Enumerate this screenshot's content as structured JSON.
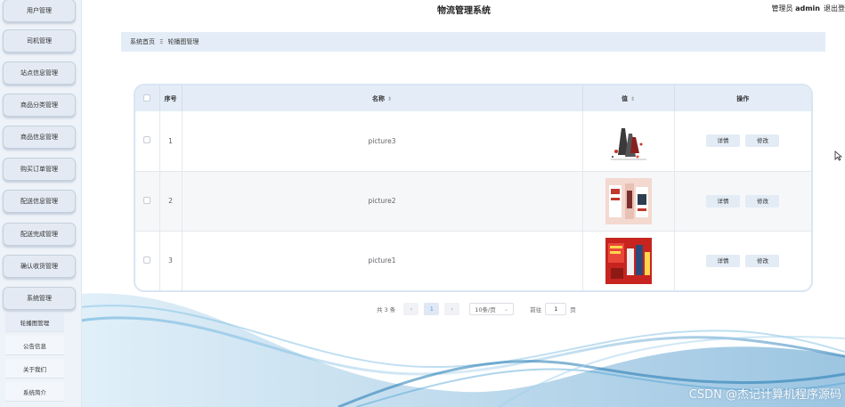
{
  "header": {
    "title": "物流管理系统",
    "admin_prefix": "管理员",
    "admin_name": "admin",
    "logout": "退出登录"
  },
  "sidebar": {
    "items": [
      {
        "label": "用户管理"
      },
      {
        "label": "司机管理"
      },
      {
        "label": "站点信息管理"
      },
      {
        "label": "商品分类管理"
      },
      {
        "label": "商品信息管理"
      },
      {
        "label": "购买订单管理"
      },
      {
        "label": "配送信息管理"
      },
      {
        "label": "配送完成管理"
      },
      {
        "label": "确认收货管理"
      },
      {
        "label": "系统管理"
      }
    ],
    "sub_items": [
      {
        "label": "轮播图管理"
      },
      {
        "label": "公告信息"
      },
      {
        "label": "关于我们"
      },
      {
        "label": "系统简介"
      }
    ]
  },
  "breadcrumb": {
    "home": "系统首页",
    "separator": "Ξ",
    "current": "轮播图管理"
  },
  "table": {
    "columns": {
      "index": "序号",
      "name": "名称",
      "value": "值",
      "actions": "操作"
    },
    "rows": [
      {
        "index": "1",
        "name": "picture3",
        "detail": "详情",
        "edit": "修改"
      },
      {
        "index": "2",
        "name": "picture2",
        "detail": "详情",
        "edit": "修改"
      },
      {
        "index": "3",
        "name": "picture1",
        "detail": "详情",
        "edit": "修改"
      }
    ]
  },
  "pagination": {
    "total": "共 3 条",
    "prev": "‹",
    "current_page": "1",
    "next": "›",
    "page_size": "10条/页",
    "goto_label": "前往",
    "goto_value": "1",
    "page_suffix": "页"
  },
  "watermark": "CSDN @杰记计算机程序源码",
  "colors": {
    "sidebar_bg": "#eef3f9",
    "header_row": "#e4edf7",
    "accent": "#409eff"
  }
}
